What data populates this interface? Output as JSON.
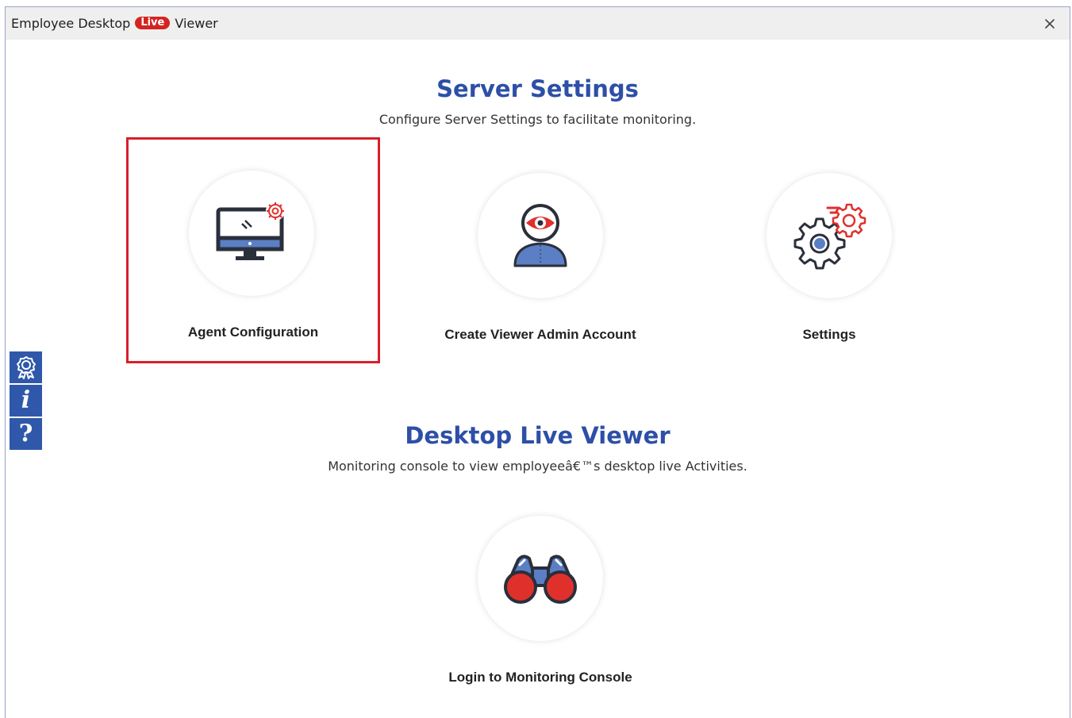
{
  "window": {
    "title_prefix": "Employee Desktop",
    "title_badge": "Live",
    "title_suffix": "Viewer",
    "close_label": "×"
  },
  "server_settings": {
    "title": "Server Settings",
    "subtitle": "Configure Server Settings to facilitate monitoring.",
    "tiles": [
      {
        "label": "Agent Configuration",
        "icon": "monitor-gear-icon",
        "selected": true
      },
      {
        "label": "Create Viewer Admin Account",
        "icon": "user-eye-icon",
        "selected": false
      },
      {
        "label": "Settings",
        "icon": "gears-icon",
        "selected": false
      }
    ]
  },
  "desktop_live_viewer": {
    "title": "Desktop Live Viewer",
    "subtitle": "Monitoring console to view employeeâ€™s desktop live Activities.",
    "tiles": [
      {
        "label": "Login to Monitoring Console",
        "icon": "binoculars-icon"
      }
    ]
  },
  "sidebar": {
    "buttons": [
      {
        "icon": "award-badge-icon"
      },
      {
        "icon": "info-icon",
        "glyph": "i"
      },
      {
        "icon": "help-icon",
        "glyph": "?"
      }
    ]
  },
  "colors": {
    "accent_blue": "#2d4fa7",
    "sidebar_blue": "#2f58aa",
    "highlight_red": "#d7202a",
    "badge_red": "#d42420",
    "icon_dark": "#2a2f3b",
    "icon_blue": "#5b7fc4",
    "icon_red": "#e0302c"
  }
}
